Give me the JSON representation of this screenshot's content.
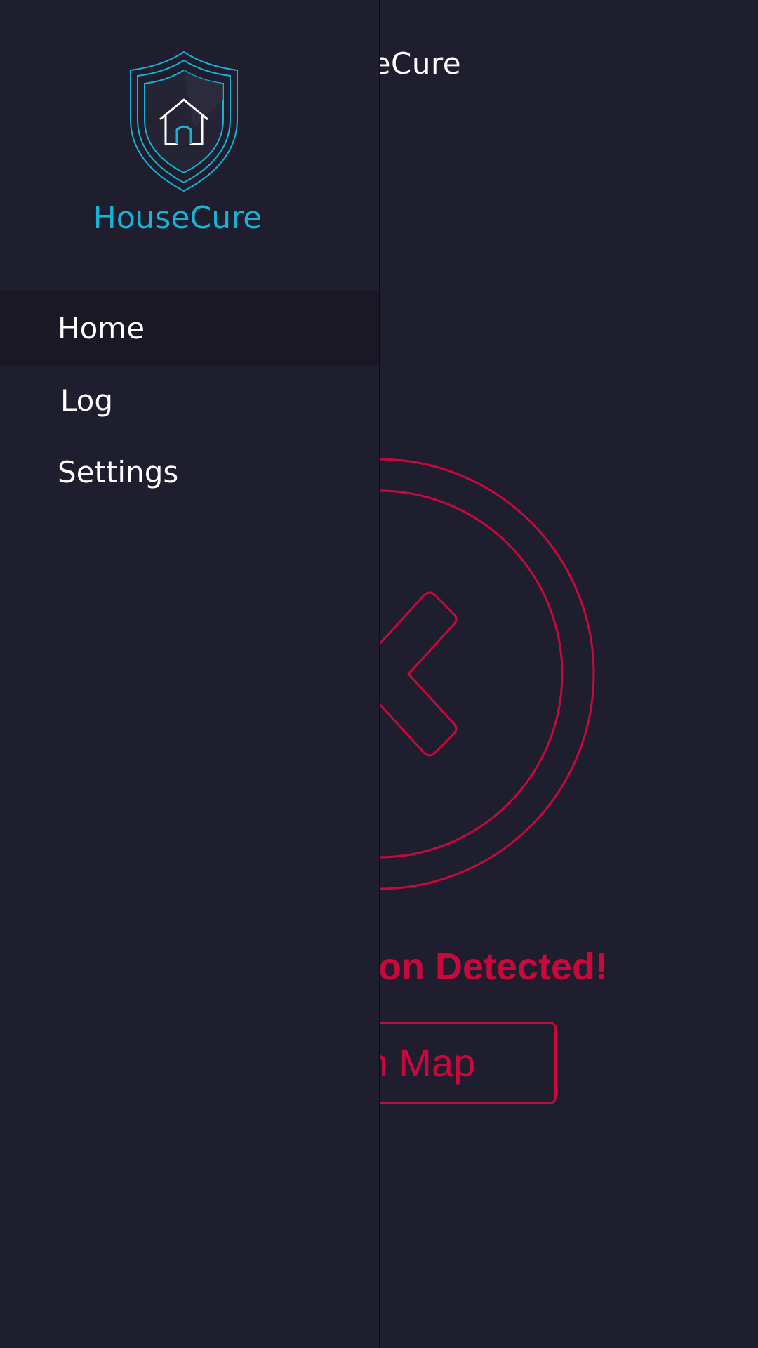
{
  "app": {
    "title": "HouseCure"
  },
  "main": {
    "title": "HouseCure",
    "alert_text": "Intrusion Detected!",
    "alert_icon": "x-circle-icon",
    "map_button_label": "Open Map"
  },
  "drawer": {
    "logo_icon": "shield-house-icon",
    "brand_name": "HouseCure",
    "items": [
      {
        "label": "Home",
        "active": true
      },
      {
        "label": "Log",
        "active": false
      },
      {
        "label": "Settings",
        "active": false
      }
    ]
  },
  "colors": {
    "background": "#1f1e2e",
    "accent": "#17b3d4",
    "alert": "#c9083e",
    "active_item": "#191824",
    "text": "#ffffff"
  }
}
